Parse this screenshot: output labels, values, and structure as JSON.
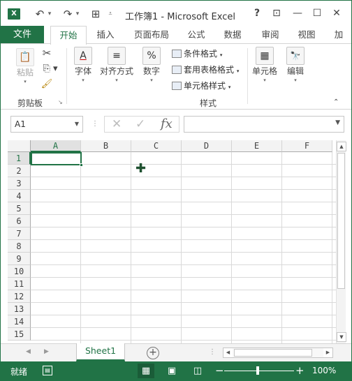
{
  "window": {
    "title": "工作簿1 - Microsoft Excel",
    "app_icon": "X"
  },
  "quick_access": {
    "undo": "↶",
    "redo": "↷",
    "touch": "⊞",
    "customize": "⩡"
  },
  "window_controls": {
    "help": "?",
    "restore_ribbon": "⊡",
    "minimize": "—",
    "maximize": "☐",
    "close": "✕"
  },
  "tabs": [
    {
      "label": "文件"
    },
    {
      "label": "开始"
    },
    {
      "label": "插入"
    },
    {
      "label": "页面布局"
    },
    {
      "label": "公式"
    },
    {
      "label": "数据"
    },
    {
      "label": "审阅"
    },
    {
      "label": "视图"
    },
    {
      "label": "加"
    }
  ],
  "ribbon": {
    "paste_label": "粘贴",
    "clipboard_group": "剪贴板",
    "font_label": "字体",
    "font_glyph": "A",
    "align_label": "对齐方式",
    "align_glyph": "≡",
    "number_label": "数字",
    "number_glyph": "%",
    "styles_group": "样式",
    "conditional_format": "条件格式",
    "table_format": "套用表格格式",
    "cell_styles": "单元格样式",
    "cells_label": "单元格",
    "edit_label": "编辑",
    "edit_glyph": "🔭"
  },
  "formula_bar": {
    "name_box": "A1",
    "value": "",
    "fx": "fx",
    "cancel": "✕",
    "enter": "✓",
    "dots": "⋮"
  },
  "grid": {
    "columns": [
      "A",
      "B",
      "C",
      "D",
      "E",
      "F"
    ],
    "rows": [
      "1",
      "2",
      "3",
      "4",
      "5",
      "6",
      "7",
      "8",
      "9",
      "10",
      "11",
      "12",
      "13",
      "14",
      "15"
    ],
    "selected_column": "A",
    "selected_row": "1"
  },
  "sheets": {
    "tabs": [
      "Sheet1"
    ],
    "add": "+",
    "prev": "◀",
    "next": "▶"
  },
  "status_bar": {
    "status": "就绪",
    "zoom": "100%",
    "minus": "−",
    "plus": "+"
  }
}
